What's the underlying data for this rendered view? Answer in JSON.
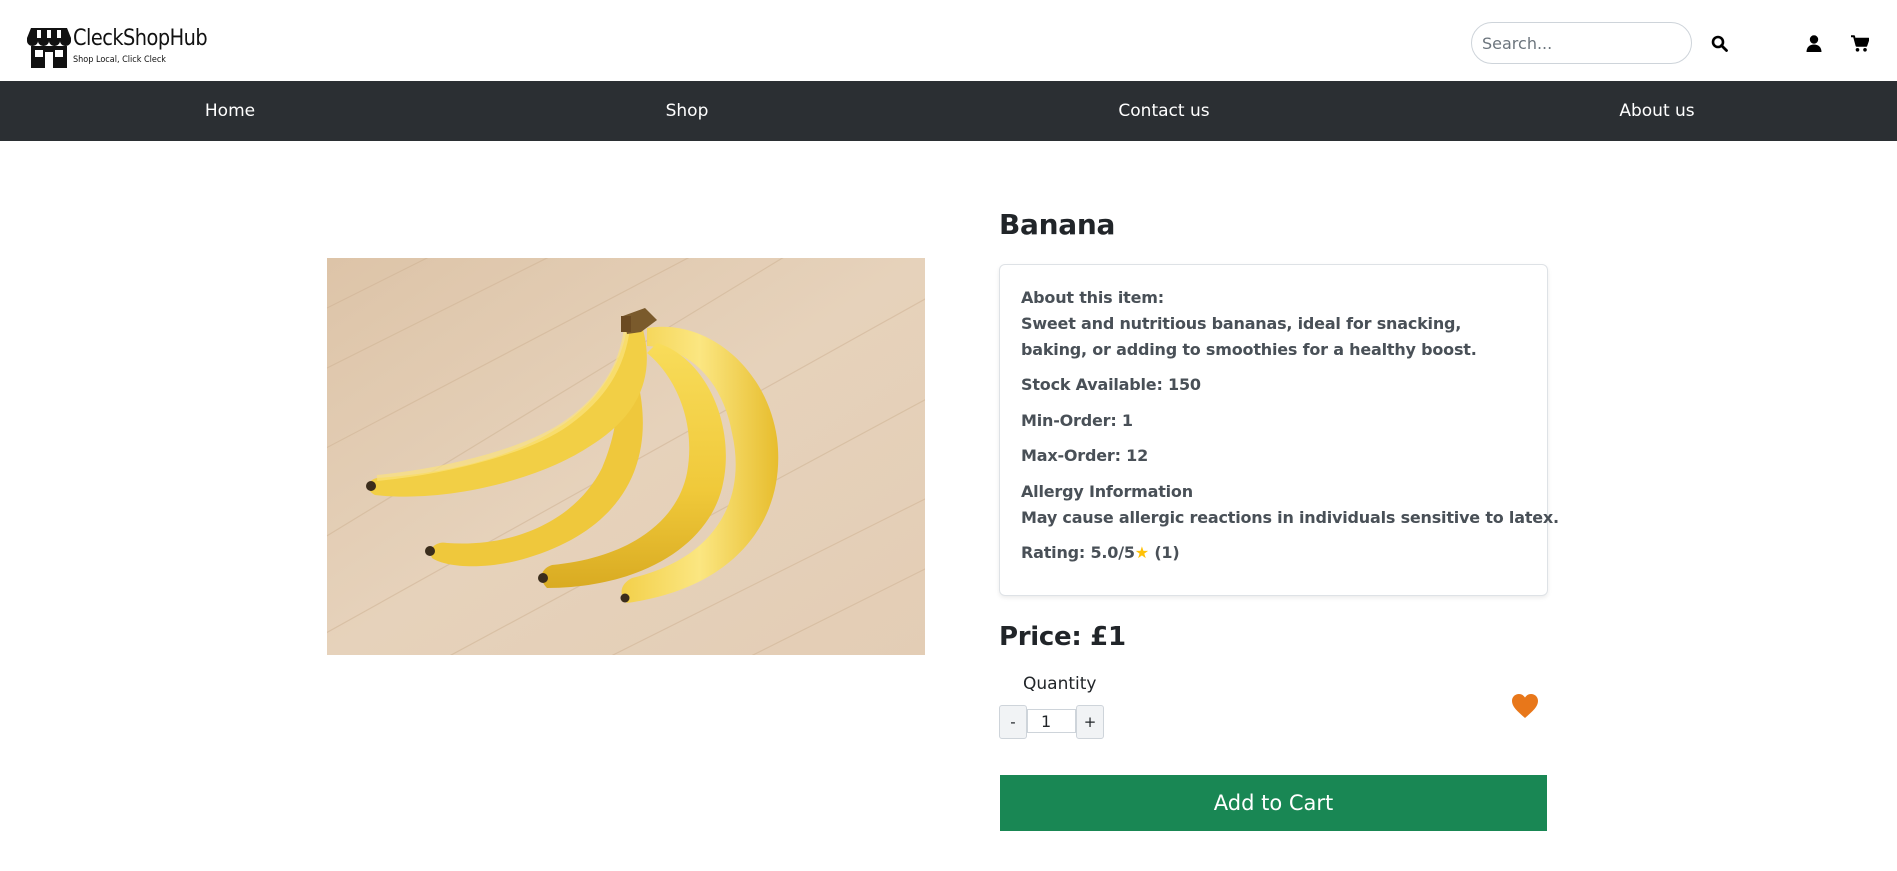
{
  "header": {
    "brand_name": "CleckShopHub",
    "brand_tagline": "Shop Local, Click Cleck",
    "search": {
      "placeholder": "Search...",
      "value": ""
    },
    "icons": [
      "search-icon",
      "user-icon",
      "cart-icon"
    ]
  },
  "nav": {
    "items": [
      {
        "label": "Home"
      },
      {
        "label": "Shop"
      },
      {
        "label": "Contact us"
      },
      {
        "label": "About us"
      }
    ]
  },
  "product": {
    "name": "Banana",
    "image_alt": "Banana",
    "about_label": "About this item:",
    "description": "Sweet and nutritious bananas, ideal for snacking, baking, or adding to smoothies for a healthy boost.",
    "stock": "Stock Available: 150",
    "min_order": "Min-Order: 1",
    "max_order": "Max-Order: 12",
    "allergy_label": "Allergy Information",
    "allergy_text": "May cause allergic reactions in individuals sensitive to latex.",
    "rating_prefix": "Rating: 5.0/5",
    "rating_star": "★",
    "rating_count": " (1)",
    "price": "Price: £1",
    "quantity_label": "Quantity",
    "quantity_value": "1",
    "minus_label": "-",
    "plus_label": "+",
    "add_to_cart_label": "Add to Cart"
  },
  "colors": {
    "nav_bg": "#2b2f33",
    "add_to_cart_bg": "#198754",
    "heart": "#e8771a",
    "star": "#ffc107"
  }
}
